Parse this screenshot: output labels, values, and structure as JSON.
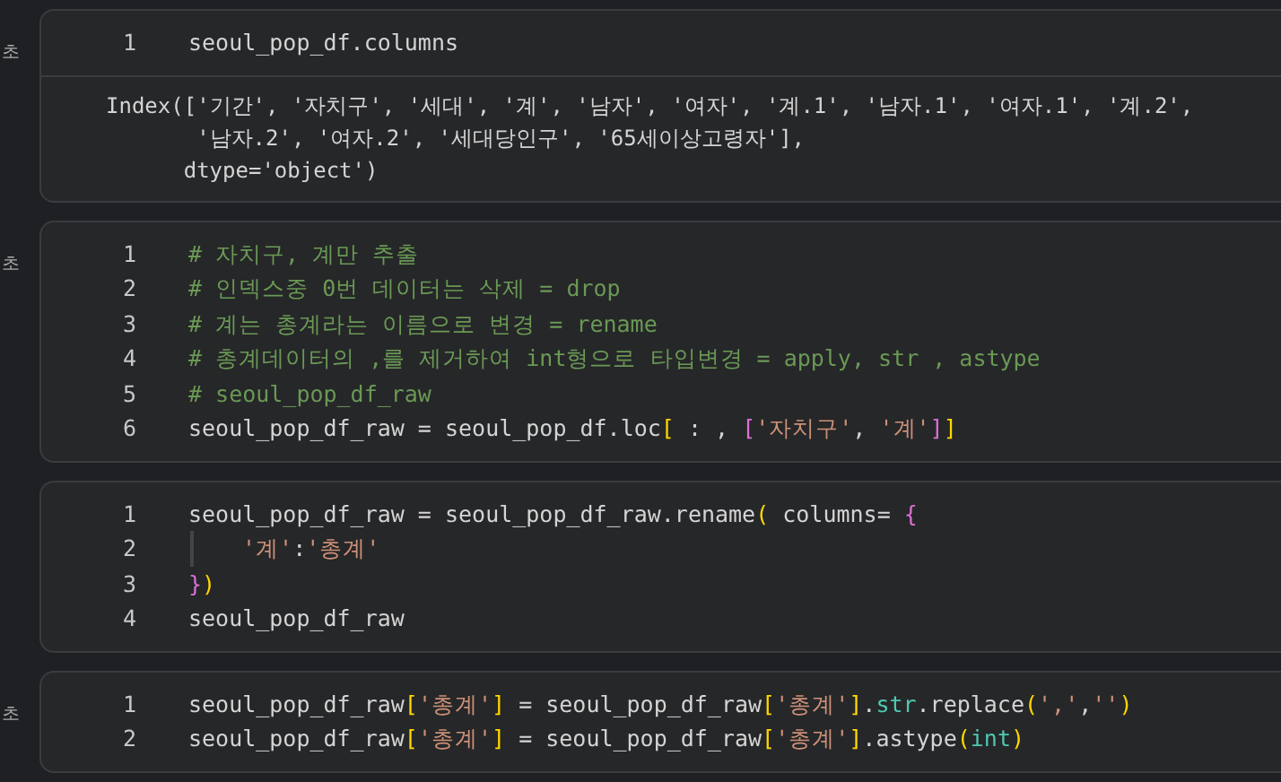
{
  "cells": [
    {
      "exec_time": "초",
      "lines": [
        {
          "number": "1",
          "tokens": [
            {
              "kind": "plain",
              "text": "seoul_pop_df.columns"
            }
          ]
        }
      ],
      "output": [
        "Index(['기간', '자치구', '세대', '계', '남자', '여자', '계.1', '남자.1', '여자.1', '계.2',",
        "       '남자.2', '여자.2', '세대당인구', '65세이상고령자'],",
        "      dtype='object')"
      ]
    },
    {
      "exec_time": "초",
      "lines": [
        {
          "number": "1",
          "tokens": [
            {
              "kind": "comment",
              "text": "# 자치구, 계만 추출"
            }
          ]
        },
        {
          "number": "2",
          "tokens": [
            {
              "kind": "comment",
              "text": "# 인덱스중 0번 데이터는 삭제 = drop"
            }
          ]
        },
        {
          "number": "3",
          "tokens": [
            {
              "kind": "comment",
              "text": "# 계는 총계라는 이름으로 변경 = rename"
            }
          ]
        },
        {
          "number": "4",
          "tokens": [
            {
              "kind": "comment",
              "text": "# 총계데이터의 ,를 제거하여 int형으로 타입변경 = apply, str , astype"
            }
          ]
        },
        {
          "number": "5",
          "tokens": [
            {
              "kind": "comment",
              "text": "# seoul_pop_df_raw"
            }
          ]
        },
        {
          "number": "6",
          "tokens": [
            {
              "kind": "plain",
              "text": "seoul_pop_df_raw = seoul_pop_df.loc"
            },
            {
              "kind": "bracket1",
              "text": "["
            },
            {
              "kind": "plain",
              "text": " : , "
            },
            {
              "kind": "bracket2",
              "text": "["
            },
            {
              "kind": "string",
              "text": "'자치구'"
            },
            {
              "kind": "plain",
              "text": ", "
            },
            {
              "kind": "string",
              "text": "'계'"
            },
            {
              "kind": "bracket2",
              "text": "]"
            },
            {
              "kind": "bracket1",
              "text": "]"
            }
          ]
        }
      ]
    },
    {
      "lines": [
        {
          "number": "1",
          "tokens": [
            {
              "kind": "plain",
              "text": "seoul_pop_df_raw = seoul_pop_df_raw.rename"
            },
            {
              "kind": "bracket1",
              "text": "("
            },
            {
              "kind": "plain",
              "text": " columns= "
            },
            {
              "kind": "bracket2",
              "text": "{"
            }
          ]
        },
        {
          "number": "2",
          "indented": true,
          "tokens": [
            {
              "kind": "string",
              "text": "'계'"
            },
            {
              "kind": "plain",
              "text": ":"
            },
            {
              "kind": "string",
              "text": "'총계'"
            }
          ]
        },
        {
          "number": "3",
          "tokens": [
            {
              "kind": "bracket2",
              "text": "}"
            },
            {
              "kind": "bracket1",
              "text": ")"
            }
          ]
        },
        {
          "number": "4",
          "tokens": [
            {
              "kind": "plain",
              "text": "seoul_pop_df_raw"
            }
          ]
        }
      ]
    },
    {
      "exec_time": "초",
      "lines": [
        {
          "number": "1",
          "tokens": [
            {
              "kind": "plain",
              "text": "seoul_pop_df_raw"
            },
            {
              "kind": "bracket1",
              "text": "["
            },
            {
              "kind": "string",
              "text": "'총계'"
            },
            {
              "kind": "bracket1",
              "text": "]"
            },
            {
              "kind": "plain",
              "text": " = seoul_pop_df_raw"
            },
            {
              "kind": "bracket1",
              "text": "["
            },
            {
              "kind": "string",
              "text": "'총계'"
            },
            {
              "kind": "bracket1",
              "text": "]"
            },
            {
              "kind": "plain",
              "text": "."
            },
            {
              "kind": "builtin",
              "text": "str"
            },
            {
              "kind": "plain",
              "text": ".replace"
            },
            {
              "kind": "bracket1",
              "text": "("
            },
            {
              "kind": "string",
              "text": "','"
            },
            {
              "kind": "plain",
              "text": ","
            },
            {
              "kind": "string",
              "text": "''"
            },
            {
              "kind": "bracket1",
              "text": ")"
            }
          ]
        },
        {
          "number": "2",
          "tokens": [
            {
              "kind": "plain",
              "text": "seoul_pop_df_raw"
            },
            {
              "kind": "bracket1",
              "text": "["
            },
            {
              "kind": "string",
              "text": "'총계'"
            },
            {
              "kind": "bracket1",
              "text": "]"
            },
            {
              "kind": "plain",
              "text": " = seoul_pop_df_raw"
            },
            {
              "kind": "bracket1",
              "text": "["
            },
            {
              "kind": "string",
              "text": "'총계'"
            },
            {
              "kind": "bracket1",
              "text": "]"
            },
            {
              "kind": "plain",
              "text": ".astype"
            },
            {
              "kind": "bracket1",
              "text": "("
            },
            {
              "kind": "builtin",
              "text": "int"
            },
            {
              "kind": "bracket1",
              "text": ")"
            }
          ]
        }
      ]
    }
  ]
}
